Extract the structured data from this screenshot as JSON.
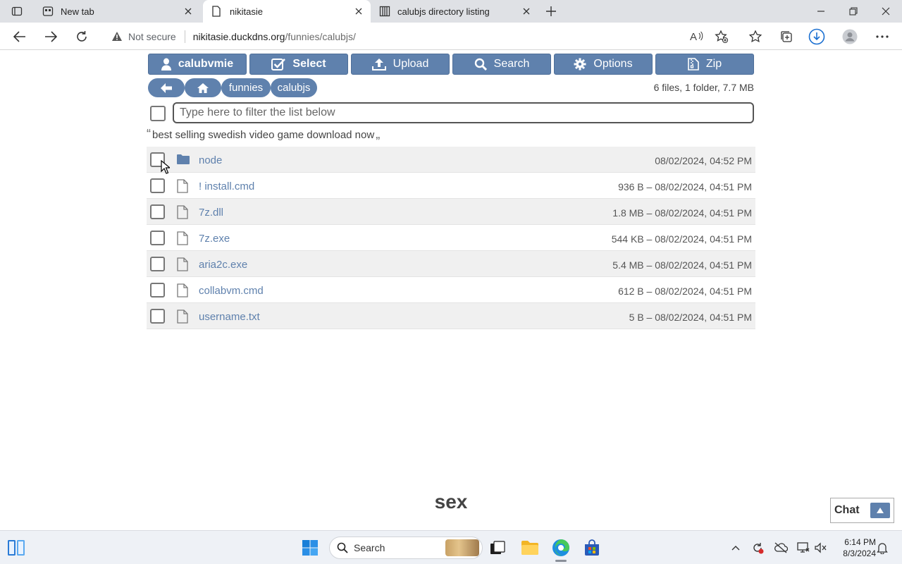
{
  "browser": {
    "tabs": [
      {
        "title": "New tab",
        "favicon": "newtab-icon",
        "active": false
      },
      {
        "title": "nikitasie",
        "favicon": "page-icon",
        "active": true
      },
      {
        "title": "calubjs directory listing",
        "favicon": "directory-icon",
        "active": false
      }
    ],
    "address": {
      "security_label": "Not secure",
      "url_host": "nikitasie.duckdns.org",
      "url_path": "/funnies/calubjs/"
    }
  },
  "toolbar_buttons": [
    {
      "label": "calubvmie",
      "icon": "user-icon"
    },
    {
      "label": "Select",
      "icon": "checkbox-icon"
    },
    {
      "label": "Upload",
      "icon": "upload-icon"
    },
    {
      "label": "Search",
      "icon": "search-icon"
    },
    {
      "label": "Options",
      "icon": "gear-icon"
    },
    {
      "label": "Zip",
      "icon": "zip-icon"
    }
  ],
  "breadcrumbs": {
    "back_icon": "arrow-left-icon",
    "home_icon": "home-icon",
    "items": [
      "funnies",
      "calubjs"
    ]
  },
  "summary": "6 files, 1 folder, 7.7 MB",
  "filter": {
    "placeholder": "Type here to filter the list below"
  },
  "readme": {
    "open_quote": "“",
    "text": "best selling swedish video game download now",
    "close_quote": "„"
  },
  "files": [
    {
      "name": "node",
      "type": "folder",
      "meta": "08/02/2024, 04:52 PM"
    },
    {
      "name": "! install.cmd",
      "type": "file",
      "meta": "936 B – 08/02/2024, 04:51 PM"
    },
    {
      "name": "7z.dll",
      "type": "file",
      "meta": "1.8 MB – 08/02/2024, 04:51 PM"
    },
    {
      "name": "7z.exe",
      "type": "file",
      "meta": "544 KB – 08/02/2024, 04:51 PM"
    },
    {
      "name": "aria2c.exe",
      "type": "file",
      "meta": "5.4 MB – 08/02/2024, 04:51 PM"
    },
    {
      "name": "collabvm.cmd",
      "type": "file",
      "meta": "612 B – 08/02/2024, 04:51 PM"
    },
    {
      "name": "username.txt",
      "type": "file",
      "meta": "5 B – 08/02/2024, 04:51 PM"
    }
  ],
  "footer_word": "sex",
  "chat": {
    "label": "Chat",
    "icon": "arrow-up-icon"
  },
  "taskbar": {
    "search_label": "Search",
    "clock_time": "6:14 PM",
    "clock_date": "8/3/2024"
  },
  "colors": {
    "accent": "#5f81ad",
    "row_shade": "#f0f0f0"
  }
}
